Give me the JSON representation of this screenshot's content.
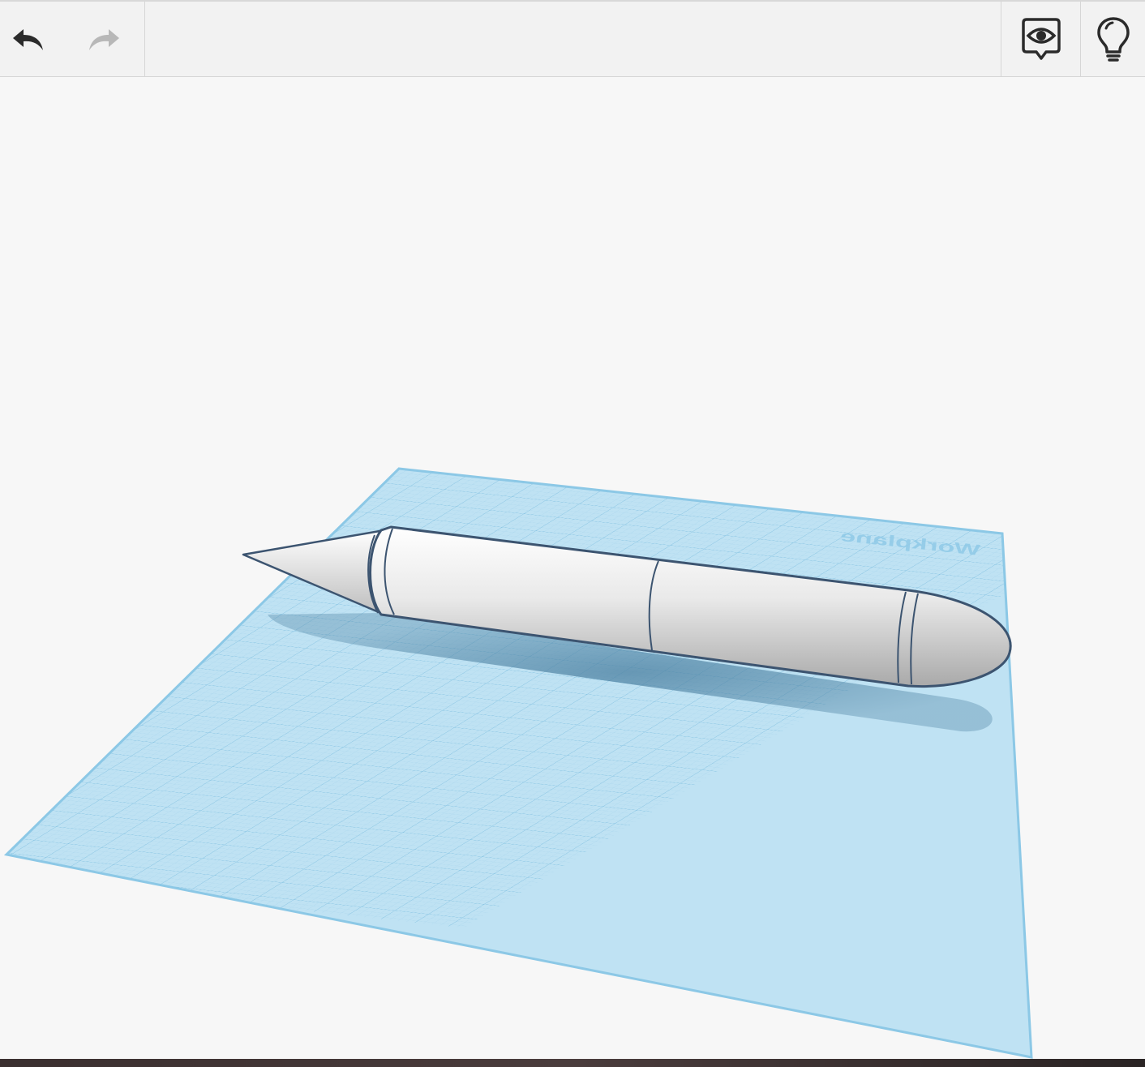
{
  "toolbar": {
    "undo": {
      "icon": "undo-icon",
      "enabled": true
    },
    "redo": {
      "icon": "redo-icon",
      "enabled": false
    },
    "view": {
      "icon": "eye-speech-bubble-icon"
    },
    "hint": {
      "icon": "lightbulb-icon"
    }
  },
  "workplane": {
    "label": "Workplane",
    "grid_color": "#8cc8e6",
    "plane_color": "#b7def2"
  },
  "model": {
    "shape": "pencil",
    "body_color": "#e8e8e8",
    "outline_color": "#3c5470"
  },
  "colors": {
    "toolbar_bg": "#f2f2f2",
    "canvas_bg": "#f7f7f7",
    "icon_dark": "#2b2b2b",
    "icon_disabled": "#b8b8b8"
  }
}
